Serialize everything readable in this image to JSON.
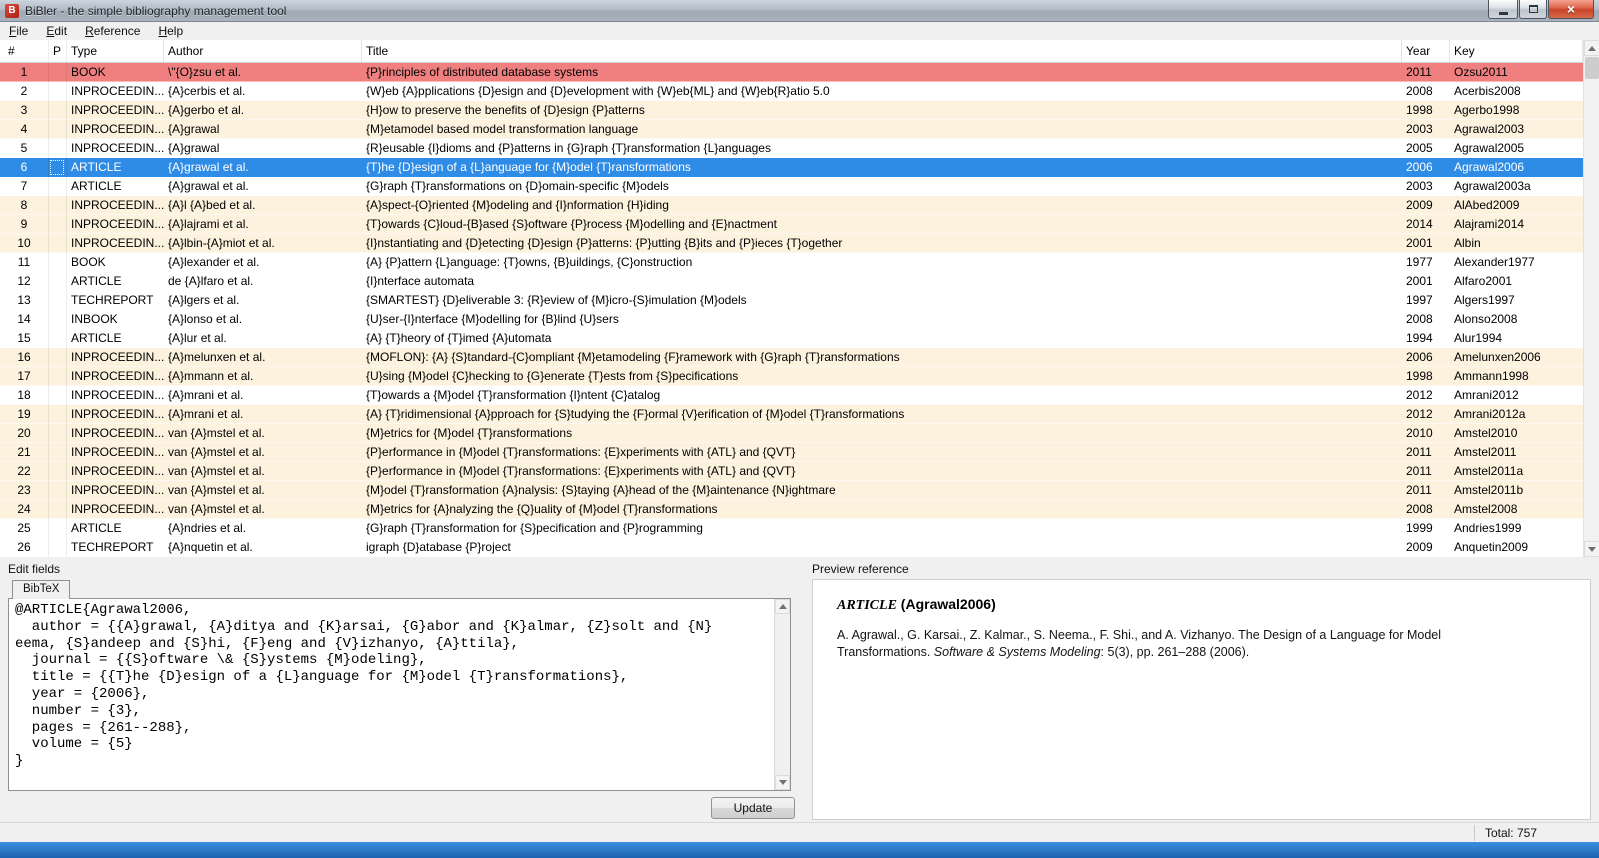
{
  "colors": {
    "error_row": "#F08080",
    "selected_row": "#2E8BE6",
    "alt_row": "#FCF2DE",
    "taskbar_top": "#3C8EDE",
    "taskbar_bottom": "#1D63B0"
  },
  "window": {
    "title": "BiBler - the simple bibliography management tool",
    "icon_letter": "B",
    "close_glyph": "×"
  },
  "menu": {
    "items": [
      {
        "label": "File"
      },
      {
        "label": "Edit"
      },
      {
        "label": "Reference"
      },
      {
        "label": "Help"
      }
    ]
  },
  "table": {
    "columns": [
      "#",
      "P",
      "Type",
      "Author",
      "Title",
      "Year",
      "Key"
    ],
    "rows": [
      {
        "num": "1",
        "p": "",
        "type": "BOOK",
        "author": "\\\"{O}zsu et al.",
        "title": "{P}rinciples of distributed database systems",
        "year": "2011",
        "key": "Ozsu2011",
        "state": "error"
      },
      {
        "num": "2",
        "p": "",
        "type": "INPROCEEDIN...",
        "author": "{A}cerbis et al.",
        "title": "{W}eb {A}pplications {D}esign and {D}evelopment with {W}eb{ML} and {W}eb{R}atio 5.0",
        "year": "2008",
        "key": "Acerbis2008",
        "state": "white"
      },
      {
        "num": "3",
        "p": "",
        "type": "INPROCEEDIN...",
        "author": "{A}gerbo et al.",
        "title": "{H}ow to preserve the benefits of {D}esign {P}atterns",
        "year": "1998",
        "key": "Agerbo1998",
        "state": "alt"
      },
      {
        "num": "4",
        "p": "",
        "type": "INPROCEEDIN...",
        "author": "{A}grawal",
        "title": "{M}etamodel based model transformation language",
        "year": "2003",
        "key": "Agrawal2003",
        "state": "alt"
      },
      {
        "num": "5",
        "p": "",
        "type": "INPROCEEDIN...",
        "author": "{A}grawal",
        "title": "{R}eusable {I}dioms and {P}atterns in {G}raph {T}ransformation {L}anguages",
        "year": "2005",
        "key": "Agrawal2005",
        "state": "white"
      },
      {
        "num": "6",
        "p": "",
        "type": "ARTICLE",
        "author": "{A}grawal et al.",
        "title": "{T}he {D}esign of a {L}anguage for {M}odel {T}ransformations",
        "year": "2006",
        "key": "Agrawal2006",
        "state": "selected"
      },
      {
        "num": "7",
        "p": "",
        "type": "ARTICLE",
        "author": "{A}grawal et al.",
        "title": "{G}raph {T}ransformations on {D}omain-specific {M}odels",
        "year": "2003",
        "key": "Agrawal2003a",
        "state": "white"
      },
      {
        "num": "8",
        "p": "",
        "type": "INPROCEEDIN...",
        "author": "{A}l {A}bed et al.",
        "title": "{A}spect-{O}riented {M}odeling and {I}nformation {H}iding",
        "year": "2009",
        "key": "AlAbed2009",
        "state": "alt"
      },
      {
        "num": "9",
        "p": "",
        "type": "INPROCEEDIN...",
        "author": "{A}lajrami et al.",
        "title": "{T}owards {C}loud-{B}ased {S}oftware {P}rocess {M}odelling and {E}nactment",
        "year": "2014",
        "key": "Alajrami2014",
        "state": "alt"
      },
      {
        "num": "10",
        "p": "",
        "type": "INPROCEEDIN...",
        "author": "{A}lbin-{A}miot et al.",
        "title": "{I}nstantiating and {D}etecting {D}esign {P}atterns: {P}utting {B}its and {P}ieces {T}ogether",
        "year": "2001",
        "key": "Albin",
        "state": "alt"
      },
      {
        "num": "11",
        "p": "",
        "type": "BOOK",
        "author": "{A}lexander et al.",
        "title": "{A} {P}attern {L}anguage: {T}owns, {B}uildings, {C}onstruction",
        "year": "1977",
        "key": "Alexander1977",
        "state": "white"
      },
      {
        "num": "12",
        "p": "",
        "type": "ARTICLE",
        "author": "de {A}lfaro et al.",
        "title": "{I}nterface automata",
        "year": "2001",
        "key": "Alfaro2001",
        "state": "white"
      },
      {
        "num": "13",
        "p": "",
        "type": "TECHREPORT",
        "author": "{A}lgers et al.",
        "title": "{SMARTEST} {D}eliverable 3: {R}eview of {M}icro-{S}imulation {M}odels",
        "year": "1997",
        "key": "Algers1997",
        "state": "white"
      },
      {
        "num": "14",
        "p": "",
        "type": "INBOOK",
        "author": "{A}lonso et al.",
        "title": "{U}ser-{I}nterface {M}odelling for {B}lind {U}sers",
        "year": "2008",
        "key": "Alonso2008",
        "state": "white"
      },
      {
        "num": "15",
        "p": "",
        "type": "ARTICLE",
        "author": "{A}lur et al.",
        "title": "{A} {T}heory of {T}imed {A}utomata",
        "year": "1994",
        "key": "Alur1994",
        "state": "white"
      },
      {
        "num": "16",
        "p": "",
        "type": "INPROCEEDIN...",
        "author": "{A}melunxen et al.",
        "title": "{MOFLON}: {A} {S}tandard-{C}ompliant {M}etamodeling {F}ramework with {G}raph {T}ransformations",
        "year": "2006",
        "key": "Amelunxen2006",
        "state": "alt"
      },
      {
        "num": "17",
        "p": "",
        "type": "INPROCEEDIN...",
        "author": "{A}mmann et al.",
        "title": "{U}sing {M}odel {C}hecking to {G}enerate {T}ests from {S}pecifications",
        "year": "1998",
        "key": "Ammann1998",
        "state": "alt"
      },
      {
        "num": "18",
        "p": "",
        "type": "INPROCEEDIN...",
        "author": "{A}mrani et al.",
        "title": "{T}owards a {M}odel {T}ransformation {I}ntent {C}atalog",
        "year": "2012",
        "key": "Amrani2012",
        "state": "white"
      },
      {
        "num": "19",
        "p": "",
        "type": "INPROCEEDIN...",
        "author": "{A}mrani et al.",
        "title": "{A} {T}ridimensional {A}pproach for {S}tudying the {F}ormal {V}erification of {M}odel {T}ransformations",
        "year": "2012",
        "key": "Amrani2012a",
        "state": "alt"
      },
      {
        "num": "20",
        "p": "",
        "type": "INPROCEEDIN...",
        "author": "van {A}mstel et al.",
        "title": "{M}etrics for {M}odel {T}ransformations",
        "year": "2010",
        "key": "Amstel2010",
        "state": "alt"
      },
      {
        "num": "21",
        "p": "",
        "type": "INPROCEEDIN...",
        "author": "van {A}mstel et al.",
        "title": "{P}erformance in {M}odel {T}ransformations: {E}xperiments with {ATL} and {QVT}",
        "year": "2011",
        "key": "Amstel2011",
        "state": "alt"
      },
      {
        "num": "22",
        "p": "",
        "type": "INPROCEEDIN...",
        "author": "van {A}mstel et al.",
        "title": "{P}erformance in {M}odel {T}ransformations: {E}xperiments with {ATL} and {QVT}",
        "year": "2011",
        "key": "Amstel2011a",
        "state": "alt"
      },
      {
        "num": "23",
        "p": "",
        "type": "INPROCEEDIN...",
        "author": "van {A}mstel et al.",
        "title": "{M}odel {T}ransformation {A}nalysis: {S}taying {A}head of the {M}aintenance {N}ightmare",
        "year": "2011",
        "key": "Amstel2011b",
        "state": "alt"
      },
      {
        "num": "24",
        "p": "",
        "type": "INPROCEEDIN...",
        "author": "van {A}mstel et al.",
        "title": "{M}etrics for {A}nalyzing the {Q}uality of {M}odel {T}ransformations",
        "year": "2008",
        "key": "Amstel2008",
        "state": "alt"
      },
      {
        "num": "25",
        "p": "",
        "type": "ARTICLE",
        "author": "{A}ndries et al.",
        "title": "{G}raph {T}ransformation for {S}pecification and {P}rogramming",
        "year": "1999",
        "key": "Andries1999",
        "state": "white"
      },
      {
        "num": "26",
        "p": "",
        "type": "TECHREPORT",
        "author": "{A}nquetin et al.",
        "title": "igraph {D}atabase {P}roject",
        "year": "2009",
        "key": "Anquetin2009",
        "state": "white"
      }
    ]
  },
  "edit_panel": {
    "label": "Edit fields",
    "tab": "BibTeX",
    "content": "@ARTICLE{Agrawal2006,\n  author = {{A}grawal, {A}ditya and {K}arsai, {G}abor and {K}almar, {Z}solt and {N}\neema, {S}andeep and {S}hi, {F}eng and {V}izhanyo, {A}ttila},\n  journal = {{S}oftware \\& {S}ystems {M}odeling},\n  title = {{T}he {D}esign of a {L}anguage for {M}odel {T}ransformations},\n  year = {2006},\n  number = {3},\n  pages = {261--288},\n  volume = {5}\n}",
    "update_label": "Update"
  },
  "preview": {
    "label": "Preview reference",
    "entry_type": "ARTICLE",
    "entry_key": "(Agrawal2006)",
    "body_before_italic": "A. Agrawal., G. Karsai., Z. Kalmar., S. Neema., F. Shi., and A. Vizhanyo. The Design of a Language for Model Transformations. ",
    "body_italic": "Software & Systems Modeling",
    "body_after_italic": ": 5(3), pp. 261–288 (2006)."
  },
  "status_bar": {
    "total": "Total: 757"
  }
}
